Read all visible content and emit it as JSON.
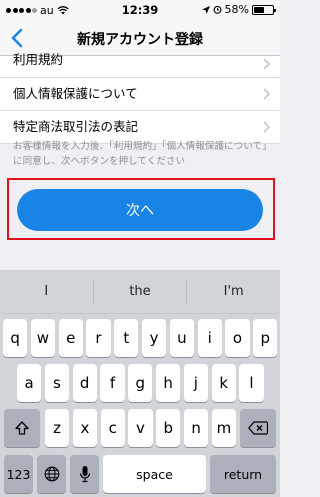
{
  "status_bar": {
    "carrier": "au",
    "time": "12:39",
    "battery_text": "58%",
    "battery_level": 0.58
  },
  "nav": {
    "title": "新規アカウント登録"
  },
  "list": {
    "items": [
      {
        "label": "利用規約"
      },
      {
        "label": "個人情報保護について"
      },
      {
        "label": "特定商法取引法の表記"
      }
    ]
  },
  "notice": {
    "text": "お客様情報を入力後、「利用規約」「個人情報保護について」に同意し、次へボタンを押してください"
  },
  "next_button": {
    "label": "次へ"
  },
  "keyboard": {
    "predictions": [
      "I",
      "the",
      "I'm"
    ],
    "row1": [
      "q",
      "w",
      "e",
      "r",
      "t",
      "y",
      "u",
      "i",
      "o",
      "p"
    ],
    "row2": [
      "a",
      "s",
      "d",
      "f",
      "g",
      "h",
      "j",
      "k",
      "l"
    ],
    "row3": [
      "z",
      "x",
      "c",
      "v",
      "b",
      "n",
      "m"
    ],
    "numbers_label": "123",
    "space_label": "space",
    "return_label": "return"
  },
  "colors": {
    "accent": "#1a84e6",
    "highlight": "#e0101c"
  }
}
